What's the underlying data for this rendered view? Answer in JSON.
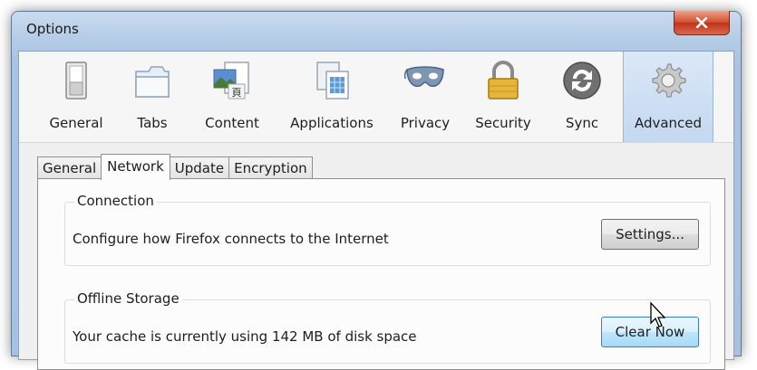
{
  "window": {
    "title": "Options"
  },
  "toolbar": {
    "panes": [
      {
        "label": "General",
        "icon": "general-switch-icon"
      },
      {
        "label": "Tabs",
        "icon": "tabs-icon"
      },
      {
        "label": "Content",
        "icon": "content-icon"
      },
      {
        "label": "Applications",
        "icon": "applications-icon"
      },
      {
        "label": "Privacy",
        "icon": "privacy-mask-icon"
      },
      {
        "label": "Security",
        "icon": "security-lock-icon"
      },
      {
        "label": "Sync",
        "icon": "sync-icon"
      },
      {
        "label": "Advanced",
        "icon": "advanced-gear-icon"
      }
    ],
    "active_pane": "Advanced"
  },
  "tabs": [
    "General",
    "Network",
    "Update",
    "Encryption"
  ],
  "active_tab": "Network",
  "connection": {
    "legend": "Connection",
    "description": "Configure how Firefox connects to the Internet",
    "button_label": "Settings..."
  },
  "offline_storage": {
    "legend": "Offline Storage",
    "description": "Your cache is currently using 142 MB of disk space",
    "button_label": "Clear Now"
  },
  "colors": {
    "active_pane_bg": "#c4d8f0",
    "close_button": "#c0321b",
    "hover_button": "#bee6fd"
  }
}
